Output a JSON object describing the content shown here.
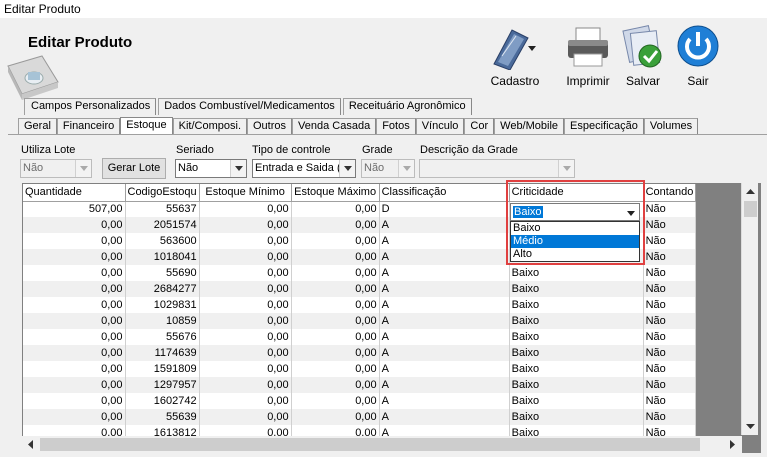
{
  "window": {
    "title": "Editar Produto"
  },
  "header": {
    "title": "Editar Produto"
  },
  "toolbar": {
    "cadastro": "Cadastro",
    "imprimir": "Imprimir",
    "salvar": "Salvar",
    "sair": "Sair"
  },
  "tabs_row1": [
    "Campos Personalizados",
    "Dados Combustível/Medicamentos",
    "Receituário Agronômico"
  ],
  "tabs_row2": [
    "Geral",
    "Financeiro",
    "Estoque",
    "Kit/Composi.",
    "Outros",
    "Venda Casada",
    "Fotos",
    "Vínculo",
    "Cor",
    "Web/Mobile",
    "Especificação",
    "Volumes"
  ],
  "active_tab": "Estoque",
  "form": {
    "utiliza_lote_label": "Utiliza Lote",
    "utiliza_lote_value": "Não",
    "gerar_lote": "Gerar Lote",
    "seriado_label": "Seriado",
    "seriado_value": "Não",
    "tipo_controle_label": "Tipo de controle",
    "tipo_controle_value": "Entrada e Saida (",
    "grade_label": "Grade",
    "grade_value": "Não",
    "descricao_grade_label": "Descrição da Grade",
    "descricao_grade_value": ""
  },
  "grid": {
    "columns": [
      "Quantidade",
      "CodigoEstoqu",
      "Estoque Mínimo",
      "Estoque Máximo",
      "Classificação",
      "Criticidade",
      "Contando"
    ],
    "rows": [
      [
        "507,00",
        "55637",
        "0,00",
        "0,00",
        "D",
        "Baixo",
        "Não"
      ],
      [
        "0,00",
        "2051574",
        "0,00",
        "0,00",
        "A",
        "",
        "Não"
      ],
      [
        "0,00",
        "563600",
        "0,00",
        "0,00",
        "A",
        "",
        "Não"
      ],
      [
        "0,00",
        "1018041",
        "0,00",
        "0,00",
        "A",
        "",
        "Não"
      ],
      [
        "0,00",
        "55690",
        "0,00",
        "0,00",
        "A",
        "Baixo",
        "Não"
      ],
      [
        "0,00",
        "2684277",
        "0,00",
        "0,00",
        "A",
        "Baixo",
        "Não"
      ],
      [
        "0,00",
        "1029831",
        "0,00",
        "0,00",
        "A",
        "Baixo",
        "Não"
      ],
      [
        "0,00",
        "10859",
        "0,00",
        "0,00",
        "A",
        "Baixo",
        "Não"
      ],
      [
        "0,00",
        "55676",
        "0,00",
        "0,00",
        "A",
        "Baixo",
        "Não"
      ],
      [
        "0,00",
        "1174639",
        "0,00",
        "0,00",
        "A",
        "Baixo",
        "Não"
      ],
      [
        "0,00",
        "1591809",
        "0,00",
        "0,00",
        "A",
        "Baixo",
        "Não"
      ],
      [
        "0,00",
        "1297957",
        "0,00",
        "0,00",
        "A",
        "Baixo",
        "Não"
      ],
      [
        "0,00",
        "1602742",
        "0,00",
        "0,00",
        "A",
        "Baixo",
        "Não"
      ],
      [
        "0,00",
        "55639",
        "0,00",
        "0,00",
        "A",
        "Baixo",
        "Não"
      ],
      [
        "0,00",
        "1613812",
        "0,00",
        "0,00",
        "A",
        "Baixo",
        "Não"
      ]
    ]
  },
  "criticidade_dropdown": {
    "current": "Baixo",
    "options": [
      "Baixo",
      "Médio",
      "Alto"
    ],
    "highlighted": "Médio"
  },
  "colors": {
    "selection": "#0078d7",
    "highlight_box": "#e04040"
  }
}
